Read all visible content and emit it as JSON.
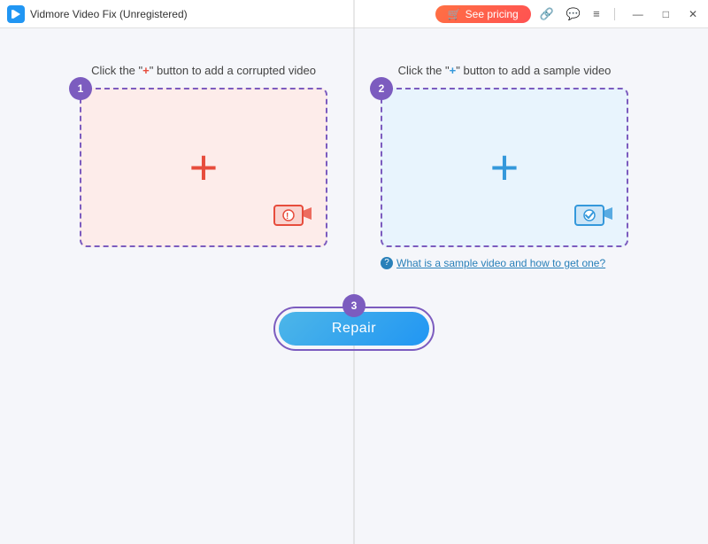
{
  "titlebar": {
    "logo_text": "V",
    "title": "Vidmore Video Fix (Unregistered)",
    "pricing_label": "See pricing",
    "icons": {
      "link": "🔗",
      "chat": "💬",
      "menu": "≡"
    },
    "window_controls": {
      "minimize": "—",
      "maximize": "□",
      "close": "✕"
    }
  },
  "left_panel": {
    "step": "1",
    "instruction_prefix": "Click the \"",
    "instruction_plus": "+",
    "instruction_suffix": "\" button to add a corrupted video"
  },
  "right_panel": {
    "step": "2",
    "instruction_prefix": "Click the \"",
    "instruction_plus": "+",
    "instruction_suffix": "\" button to add a sample video",
    "sample_link": "What is a sample video and how to get one?"
  },
  "repair": {
    "step": "3",
    "button_label": "Repair"
  }
}
